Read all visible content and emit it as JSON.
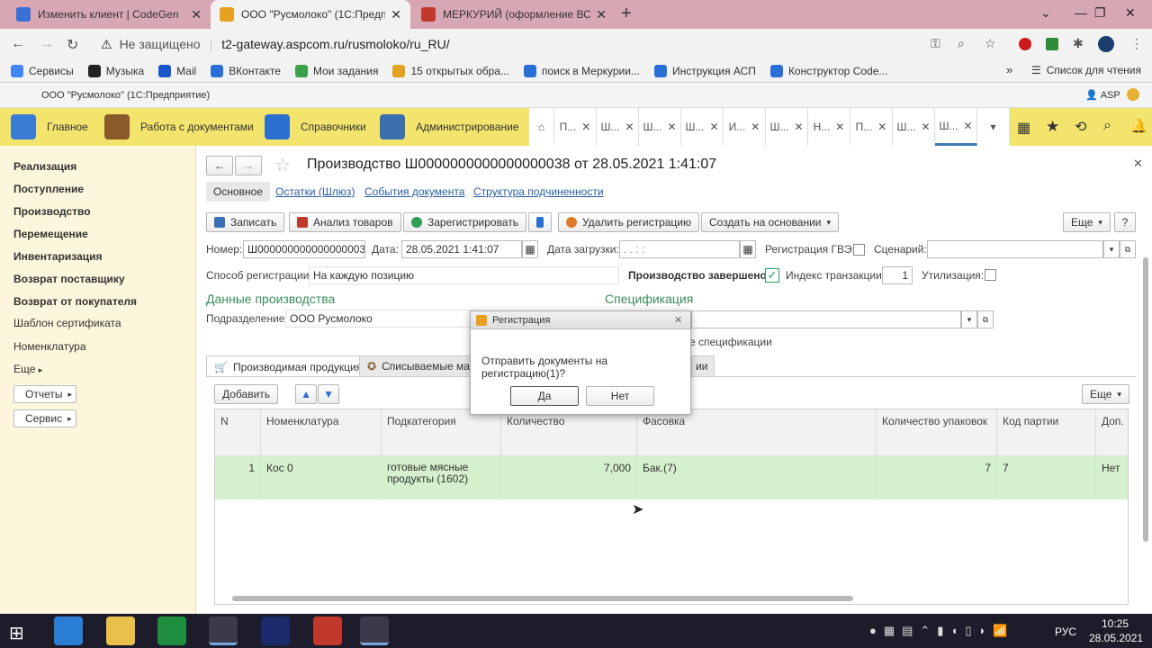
{
  "browser": {
    "tabs": [
      {
        "title": "Изменить клиент | CodeGen",
        "color": "#3b6fd6"
      },
      {
        "title": "ООО \"Русмолоко\" (1С:Предпри",
        "color": "#e8a020"
      },
      {
        "title": "МЕРКУРИЙ (оформление ВСД)",
        "color": "#c0392b"
      }
    ],
    "not_secure": "Не защищено",
    "url": "t2-gateway.aspcom.ru/rusmoloko/ru_RU/",
    "bookmarks": [
      {
        "label": "Сервисы",
        "color": "#4285f4"
      },
      {
        "label": "Музыка",
        "color": "#222"
      },
      {
        "label": "Mail",
        "color": "#1a56c9"
      },
      {
        "label": "ВКонтакте",
        "color": "#2a6fd6"
      },
      {
        "label": "Мои задания",
        "color": "#3aa04a"
      },
      {
        "label": "15 открытых обра...",
        "color": "#e0a020"
      },
      {
        "label": "поиск в Меркурии...",
        "color": "#2a6fd6"
      },
      {
        "label": "Инструкция АСП",
        "color": "#2a6fd6"
      },
      {
        "label": "Конструктор Code...",
        "color": "#2a6fd6"
      }
    ],
    "more_bookmarks": "»",
    "reading_list": "Список для чтения"
  },
  "app": {
    "window_title": "ООО \"Русмолоко\" (1С:Предприятие)",
    "user": "ASP",
    "sections": [
      {
        "label": "Главное",
        "color": "#3a7bd5"
      },
      {
        "label": "Работа с документами",
        "color": "#8a5a2b"
      },
      {
        "label": "Справочники",
        "color": "#2b6fd0"
      },
      {
        "label": "Администрирование",
        "color": "#3b6fb0"
      }
    ],
    "open_tabs": [
      "П...",
      "Ш...",
      "Ш...",
      "Ш...",
      "И...",
      "Ш...",
      "Н...",
      "П...",
      "Ш...",
      "Ш..."
    ]
  },
  "sidebar": {
    "items": [
      "Реализация",
      "Поступление",
      "Производство",
      "Перемещение",
      "Инвентаризация",
      "Возврат поставщику",
      "Возврат от покупателя",
      "Шаблон сертификата",
      "Номенклатура",
      "Еще"
    ],
    "buttons": [
      "Отчеты",
      "Сервис"
    ]
  },
  "document": {
    "title": "Производство Ш0000000000000000038 от 28.05.2021 1:41:07",
    "nav_tabs": [
      "Основное",
      "Остатки (Шлюз)",
      "События документа",
      "Структура подчиненности"
    ],
    "toolbar": {
      "save": "Записать",
      "analyze": "Анализ товаров",
      "register": "Зарегистрировать",
      "delete_reg": "Удалить регистрацию",
      "create_based": "Создать на основании",
      "more": "Еще",
      "help": "?"
    },
    "fields": {
      "number_label": "Номер:",
      "number_value": "Ш0000000000000000038",
      "date_label": "Дата:",
      "date_value": "28.05.2021  1:41:07",
      "load_date_label": "Дата загрузки:",
      "load_date_value": " .  .       :  :",
      "gve_label": "Регистрация ГВЭ:",
      "scenario_label": "Сценарий:",
      "reg_method_label": "Способ регистрации:",
      "reg_method_value": "На каждую позицию",
      "prod_done_label": "Производство завершено:",
      "tx_index_label": "Индекс транзакции:",
      "tx_index_value": "1",
      "disposal_label": "Утилизация:",
      "production_data": "Данные производства",
      "specification": "Спецификация",
      "division_label": "Подразделение:",
      "division_value": "ООО Русмолоко",
      "spec_hint": "е спецификации"
    },
    "inner_tabs": [
      "Производимая продукция",
      "Списываемые мат",
      "ии"
    ],
    "table_toolbar": {
      "add": "Добавить",
      "more": "Еще"
    },
    "columns": [
      "N",
      "Номенклатура",
      "Подкатегория",
      "Количество",
      "Фасовка",
      "Количество упаковок",
      "Код партии",
      "Доп."
    ],
    "rows": [
      {
        "n": "1",
        "nomenclature": "Кос 0",
        "subcategory": "готовые мясные продукты (1602)",
        "qty": "7,000",
        "packing": "Бак.(7)",
        "packs": "7",
        "batch": "7",
        "extra": "Нет"
      }
    ]
  },
  "dialog": {
    "title": "Регистрация",
    "message": "Отправить документы на регистрацию(1)?",
    "yes": "Да",
    "no": "Нет"
  },
  "taskbar": {
    "language": "РУС",
    "time": "10:25",
    "date": "28.05.2021"
  }
}
